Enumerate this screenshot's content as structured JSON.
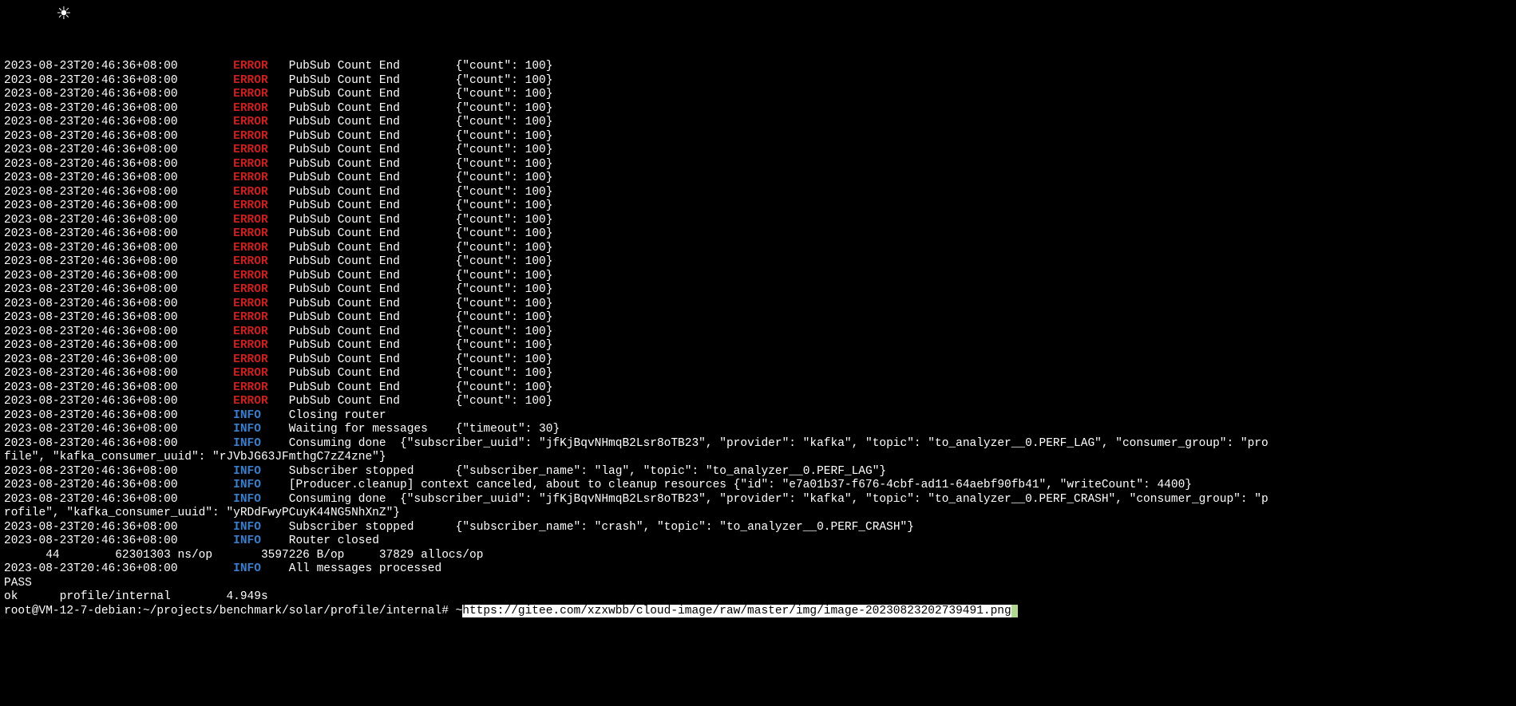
{
  "icon_glyph": "☀",
  "error_lines_count": 25,
  "timestamp": "2023-08-23T20:46:36+08:00",
  "error_level": "ERROR",
  "error_msg": "PubSub Count End",
  "error_json": "{\"count\": 100}",
  "info_level": "INFO",
  "info_lines": [
    {
      "msg": "Closing router",
      "json": ""
    },
    {
      "msg": "Waiting for messages",
      "json": "{\"timeout\": 30}"
    },
    {
      "msg": "Consuming done",
      "json": "{\"subscriber_uuid\": \"jfKjBqvNHmqB2Lsr8oTB23\", \"provider\": \"kafka\", \"topic\": \"to_analyzer__0.PERF_LAG\", \"consumer_group\": \"profile\", \"kafka_consumer_uuid\": \"rJVbJG63JFmthgC7zZ4zne\"}",
      "wrap": true,
      "wrap_at": 182
    },
    {
      "msg": "Subscriber stopped",
      "json": "{\"subscriber_name\": \"lag\", \"topic\": \"to_analyzer__0.PERF_LAG\"}"
    },
    {
      "msg": "[Producer.cleanup] context canceled, about to cleanup resources",
      "json": "{\"id\": \"e7a01b37-f676-4cbf-ad11-64aebf90fb41\", \"writeCount\": 4400}",
      "inline_json": true
    },
    {
      "msg": "Consuming done",
      "json": "{\"subscriber_uuid\": \"jfKjBqvNHmqB2Lsr8oTB23\", \"provider\": \"kafka\", \"topic\": \"to_analyzer__0.PERF_CRASH\", \"consumer_group\": \"profile\", \"kafka_consumer_uuid\": \"yRDdFwyPCuyK44NG5NhXnZ\"}",
      "wrap": true,
      "wrap_at": 182
    },
    {
      "msg": "Subscriber stopped",
      "json": "{\"subscriber_name\": \"crash\", \"topic\": \"to_analyzer__0.PERF_CRASH\"}"
    },
    {
      "msg": "Router closed",
      "json": ""
    }
  ],
  "bench_line": "      44        62301303 ns/op       3597226 B/op     37829 allocs/op",
  "all_processed_msg": "All messages processed",
  "pass": "PASS",
  "ok_line": "ok      profile/internal        4.949s",
  "prompt": "root@VM-12-7-debian:~/projects/benchmark/solar/profile/internal# ~",
  "highlighted_url": "https://gitee.com/xzxwbb/cloud-image/raw/master/img/image-20230823202739491.png",
  "col_ts_width": 33,
  "col_level_width": 8,
  "col_msg_width": 24
}
